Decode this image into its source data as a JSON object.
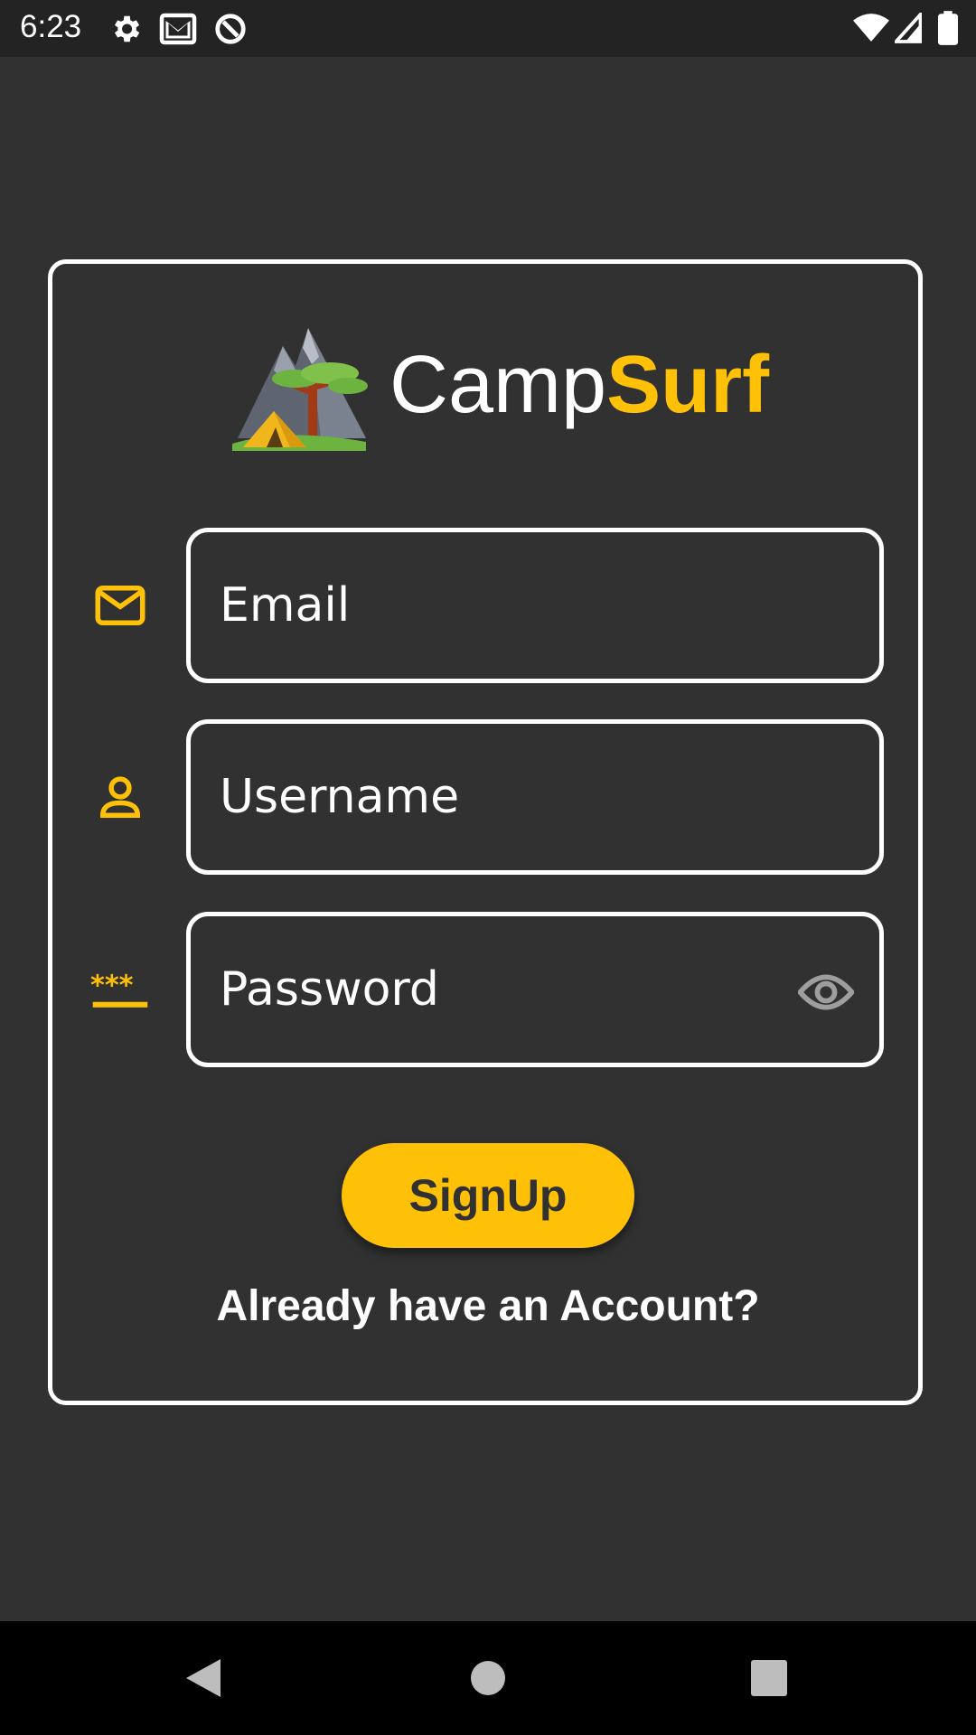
{
  "status_bar": {
    "time": "6:23",
    "icons": [
      "settings-icon",
      "gmail-icon",
      "data-saver-icon",
      "wifi-icon",
      "cell-signal-icon",
      "battery-icon"
    ]
  },
  "brand": {
    "part1": "Camp",
    "part2": "Surf",
    "accent_color": "#ffc107"
  },
  "form": {
    "email": {
      "placeholder": "Email",
      "icon": "mail-icon"
    },
    "username": {
      "placeholder": "Username",
      "icon": "person-icon"
    },
    "password": {
      "placeholder": "Password",
      "icon": "password-icon",
      "toggle_icon": "eye-icon"
    }
  },
  "signup_button": {
    "label": "SignUp"
  },
  "login_link": {
    "label": "Already have an Account?"
  },
  "nav_bar": {
    "buttons": [
      "back-icon",
      "home-icon",
      "recents-icon"
    ]
  }
}
